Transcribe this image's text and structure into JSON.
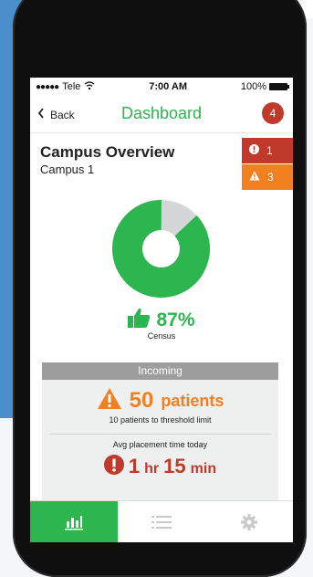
{
  "statusbar": {
    "carrier": "Tele",
    "time": "7:00 AM",
    "battery_text": "100%"
  },
  "navbar": {
    "back_label": "Back",
    "title": "Dashboard",
    "badge_count": "4"
  },
  "overview": {
    "title": "Campus Overview",
    "subtitle": "Campus 1",
    "alerts": [
      {
        "type": "critical",
        "count": "1",
        "icon": "exclamation-circle-icon",
        "color": "#c0392b"
      },
      {
        "type": "warning",
        "count": "3",
        "icon": "warning-triangle-icon",
        "color": "#f08020"
      }
    ]
  },
  "census": {
    "value": "87%",
    "label": "Census",
    "fraction": 0.87
  },
  "incoming": {
    "header": "Incoming",
    "patients_number": "50",
    "patients_unit": "patients",
    "threshold_note": "10 patients to threshold limit",
    "avg_label": "Avg placement time today",
    "avg_hr_value": "1",
    "avg_hr_unit": "hr",
    "avg_min_value": "15",
    "avg_min_unit": "min"
  },
  "tabbar": {
    "tabs": [
      {
        "name": "chart-tab",
        "icon": "bar-chart-icon",
        "active": true
      },
      {
        "name": "list-tab",
        "icon": "list-icon",
        "active": false
      },
      {
        "name": "settings-tab",
        "icon": "gear-icon",
        "active": false
      }
    ]
  },
  "colors": {
    "green": "#2db54f",
    "red": "#c0392b",
    "orange": "#f08020",
    "gray": "#9d9d9d",
    "blue_background": "#4a8fcc"
  }
}
